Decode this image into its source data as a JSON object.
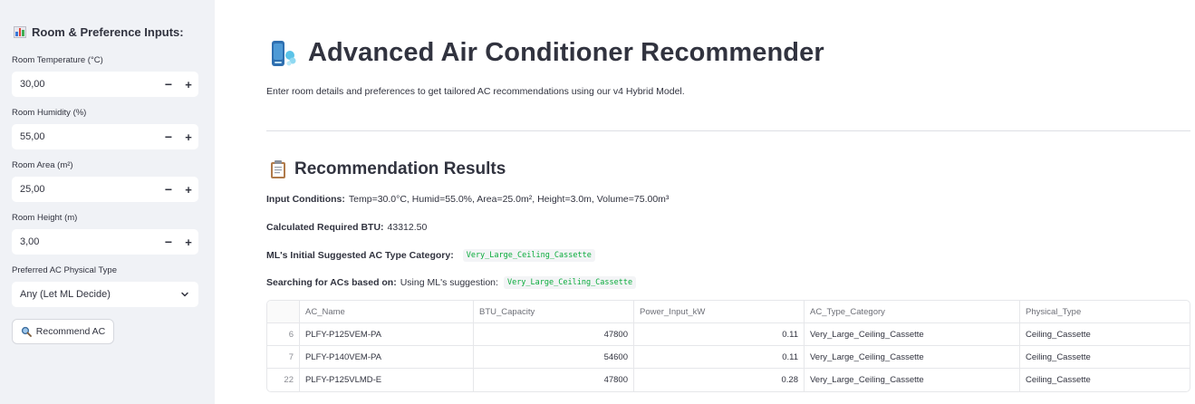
{
  "sidebar": {
    "title": "Room & Preference Inputs:",
    "title_icon": "bar-chart-icon",
    "fields": [
      {
        "label": "Room Temperature (°C)",
        "value": "30,00"
      },
      {
        "label": "Room Humidity (%)",
        "value": "55,00"
      },
      {
        "label": "Room Area (m²)",
        "value": "25,00"
      },
      {
        "label": "Room Height (m)",
        "value": "3,00"
      }
    ],
    "stepper_minus": "−",
    "stepper_plus": "+",
    "select_label": "Preferred AC Physical Type",
    "select_value": "Any (Let ML Decide)",
    "button_label": "Recommend AC",
    "button_icon": "magnifier-icon"
  },
  "main": {
    "title": "Advanced Air Conditioner Recommender",
    "title_icon": "air-conditioner-icon",
    "subtitle": "Enter room details and preferences to get tailored AC recommendations using our v4 Hybrid Model.",
    "section_title": "Recommendation Results",
    "section_icon": "clipboard-icon",
    "input_conditions": {
      "label": "Input Conditions:",
      "text": "Temp=30.0°C, Humid=55.0%, Area=25.0m², Height=3.0m, Volume=75.00m³"
    },
    "btu": {
      "label": "Calculated Required BTU:",
      "text": "43312.50"
    },
    "ml_type": {
      "label": "ML's Initial Suggested AC Type Category:",
      "code": "Very_Large_Ceiling_Cassette"
    },
    "search": {
      "label": "Searching for ACs based on:",
      "text": "Using ML's suggestion:",
      "code": "Very_Large_Ceiling_Cassette"
    }
  },
  "table": {
    "headers": [
      "",
      "AC_Name",
      "BTU_Capacity",
      "Power_Input_kW",
      "AC_Type_Category",
      "Physical_Type"
    ],
    "rows": [
      [
        "6",
        "PLFY-P125VEM-PA",
        "47800",
        "0.11",
        "Very_Large_Ceiling_Cassette",
        "Ceiling_Cassette"
      ],
      [
        "7",
        "PLFY-P140VEM-PA",
        "54600",
        "0.11",
        "Very_Large_Ceiling_Cassette",
        "Ceiling_Cassette"
      ],
      [
        "22",
        "PLFY-P125VLMD-E",
        "47800",
        "0.28",
        "Very_Large_Ceiling_Cassette",
        "Ceiling_Cassette"
      ]
    ]
  }
}
